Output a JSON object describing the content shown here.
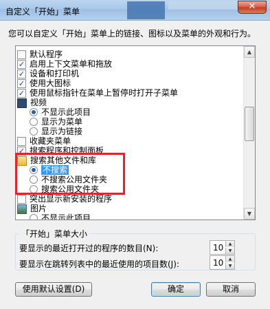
{
  "window": {
    "title": "自定义「开始」菜单",
    "close_glyph": "✕"
  },
  "description": "您可以自定义「开始」菜单上的链接、图标以及菜单的外观和行为。",
  "options": [
    {
      "type": "checkbox",
      "label": "默认程序",
      "checked": false
    },
    {
      "type": "checkbox",
      "label": "启用上下文菜单和拖放",
      "checked": true
    },
    {
      "type": "checkbox",
      "label": "设备和打印机",
      "checked": true
    },
    {
      "type": "checkbox",
      "label": "使用大图标",
      "checked": true
    },
    {
      "type": "checkbox",
      "label": "使用鼠标指针在菜单上暂停时打开子菜单",
      "checked": true
    },
    {
      "type": "group",
      "label": "视频",
      "icon": "video-icon"
    },
    {
      "type": "radio",
      "label": "不显示此项目",
      "selected": true
    },
    {
      "type": "radio",
      "label": "显示为菜单",
      "selected": false
    },
    {
      "type": "radio",
      "label": "显示为链接",
      "selected": false
    },
    {
      "type": "checkbox",
      "label": "收藏夹菜单",
      "checked": false
    },
    {
      "type": "checkbox",
      "label": "搜索程序和控制面板",
      "checked": true
    },
    {
      "type": "group",
      "label": "搜索其他文件和库",
      "icon": "folder-icon"
    },
    {
      "type": "radio",
      "label": "不搜索",
      "selected": true,
      "highlighted": true
    },
    {
      "type": "radio",
      "label": "不搜索公用文件夹",
      "selected": false
    },
    {
      "type": "radio",
      "label": "搜索公用文件夹",
      "selected": false
    },
    {
      "type": "checkbox",
      "label": "突出显示新安装的程序",
      "checked": false
    },
    {
      "type": "group",
      "label": "图片",
      "icon": "picture-icon"
    },
    {
      "type": "radio",
      "label": "不显示此项目",
      "selected": false
    }
  ],
  "size_group": {
    "legend": "「开始」菜单大小",
    "recent_programs_label": "要显示的最近打开过的程序的数目(N):",
    "recent_programs_value": "10",
    "jumplist_label": "要显示在跳转列表中的最近使用的项目数(J):",
    "jumplist_value": "10"
  },
  "buttons": {
    "defaults": "使用默认设置(D)",
    "ok": "确定",
    "cancel": "取消"
  },
  "colors": {
    "highlight": "#3399ff",
    "annotation": "#e0262b"
  }
}
